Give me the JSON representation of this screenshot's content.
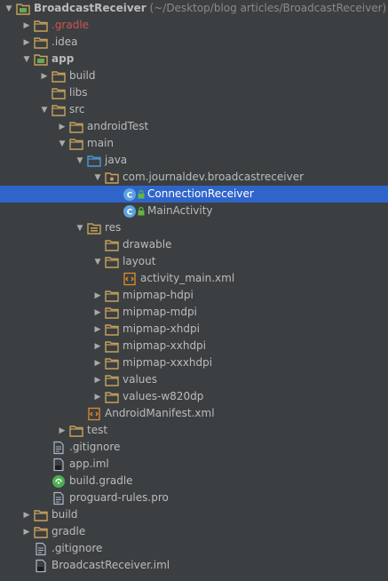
{
  "root": {
    "name": "BroadcastReceiver",
    "path": "(~/Desktop/blog articles/BroadcastReceiver)"
  },
  "tree": [
    {
      "label": "BroadcastReceiver",
      "depth": 0,
      "expanded": true,
      "icon": "module-folder-icon",
      "kind": "root"
    },
    {
      "label": ".gradle",
      "depth": 1,
      "expanded": false,
      "icon": "folder-icon",
      "kind": "red"
    },
    {
      "label": ".idea",
      "depth": 1,
      "expanded": false,
      "icon": "folder-icon"
    },
    {
      "label": "app",
      "depth": 1,
      "expanded": true,
      "icon": "module-folder-icon",
      "kind": "bold"
    },
    {
      "label": "build",
      "depth": 2,
      "expanded": false,
      "icon": "folder-icon"
    },
    {
      "label": "libs",
      "depth": 2,
      "expanded": null,
      "icon": "folder-icon"
    },
    {
      "label": "src",
      "depth": 2,
      "expanded": true,
      "icon": "folder-icon"
    },
    {
      "label": "androidTest",
      "depth": 3,
      "expanded": false,
      "icon": "folder-icon"
    },
    {
      "label": "main",
      "depth": 3,
      "expanded": true,
      "icon": "folder-icon"
    },
    {
      "label": "java",
      "depth": 4,
      "expanded": true,
      "icon": "source-folder-icon"
    },
    {
      "label": "com.journaldev.broadcastreceiver",
      "depth": 5,
      "expanded": true,
      "icon": "package-icon"
    },
    {
      "label": "ConnectionReceiver",
      "depth": 6,
      "expanded": null,
      "icon": "class-icon",
      "selected": true
    },
    {
      "label": "MainActivity",
      "depth": 6,
      "expanded": null,
      "icon": "class-icon"
    },
    {
      "label": "res",
      "depth": 4,
      "expanded": true,
      "icon": "resource-folder-icon"
    },
    {
      "label": "drawable",
      "depth": 5,
      "expanded": null,
      "icon": "folder-icon"
    },
    {
      "label": "layout",
      "depth": 5,
      "expanded": true,
      "icon": "folder-icon"
    },
    {
      "label": "activity_main.xml",
      "depth": 6,
      "expanded": null,
      "icon": "xml-file-icon"
    },
    {
      "label": "mipmap-hdpi",
      "depth": 5,
      "expanded": false,
      "icon": "folder-icon"
    },
    {
      "label": "mipmap-mdpi",
      "depth": 5,
      "expanded": false,
      "icon": "folder-icon"
    },
    {
      "label": "mipmap-xhdpi",
      "depth": 5,
      "expanded": false,
      "icon": "folder-icon"
    },
    {
      "label": "mipmap-xxhdpi",
      "depth": 5,
      "expanded": false,
      "icon": "folder-icon"
    },
    {
      "label": "mipmap-xxxhdpi",
      "depth": 5,
      "expanded": false,
      "icon": "folder-icon"
    },
    {
      "label": "values",
      "depth": 5,
      "expanded": false,
      "icon": "folder-icon"
    },
    {
      "label": "values-w820dp",
      "depth": 5,
      "expanded": false,
      "icon": "folder-icon"
    },
    {
      "label": "AndroidManifest.xml",
      "depth": 4,
      "expanded": null,
      "icon": "xml-file-icon"
    },
    {
      "label": "test",
      "depth": 3,
      "expanded": false,
      "icon": "folder-icon"
    },
    {
      "label": ".gitignore",
      "depth": 2,
      "expanded": null,
      "icon": "text-file-icon"
    },
    {
      "label": "app.iml",
      "depth": 2,
      "expanded": null,
      "icon": "iml-file-icon"
    },
    {
      "label": "build.gradle",
      "depth": 2,
      "expanded": null,
      "icon": "gradle-file-icon"
    },
    {
      "label": "proguard-rules.pro",
      "depth": 2,
      "expanded": null,
      "icon": "text-file-icon"
    },
    {
      "label": "build",
      "depth": 1,
      "expanded": false,
      "icon": "folder-icon"
    },
    {
      "label": "gradle",
      "depth": 1,
      "expanded": false,
      "icon": "folder-icon"
    },
    {
      "label": ".gitignore",
      "depth": 1,
      "expanded": null,
      "icon": "text-file-icon"
    },
    {
      "label": "BroadcastReceiver.iml",
      "depth": 1,
      "expanded": null,
      "icon": "iml-file-icon"
    }
  ],
  "colors": {
    "background": "#3c3f41",
    "selection": "#2f65ca",
    "text": "#bbbbbb",
    "folder": "#c6a15b",
    "ignored_red": "#d25252",
    "class_icon": "#5da4e0",
    "lock_green": "#62b543",
    "xml_orange": "#e08a2e"
  }
}
